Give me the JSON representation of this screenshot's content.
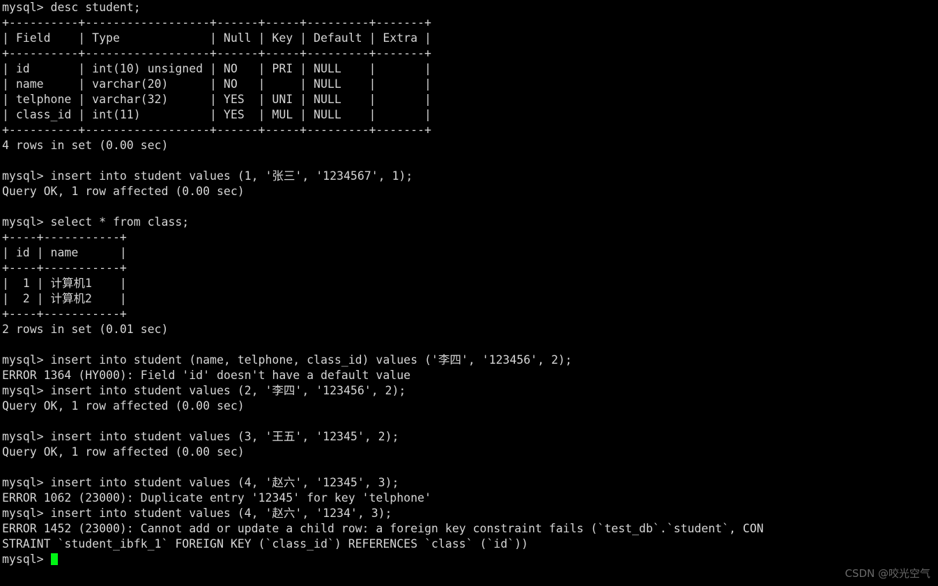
{
  "terminal": {
    "title": "mysql client session",
    "prompt": "mysql> ",
    "background_color": "#000000",
    "text_color": "#d6d6d6",
    "cursor_color": "#00f514",
    "lines": [
      "mysql> desc student;",
      "+----------+------------------+------+-----+---------+-------+",
      "| Field    | Type             | Null | Key | Default | Extra |",
      "+----------+------------------+------+-----+---------+-------+",
      "| id       | int(10) unsigned | NO   | PRI | NULL    |       |",
      "| name     | varchar(20)      | NO   |     | NULL    |       |",
      "| telphone | varchar(32)      | YES  | UNI | NULL    |       |",
      "| class_id | int(11)          | YES  | MUL | NULL    |       |",
      "+----------+------------------+------+-----+---------+-------+",
      "4 rows in set (0.00 sec)",
      "",
      "mysql> insert into student values (1, '张三', '1234567', 1);",
      "Query OK, 1 row affected (0.00 sec)",
      "",
      "mysql> select * from class;",
      "+----+-----------+",
      "| id | name      |",
      "+----+-----------+",
      "|  1 | 计算机1    |",
      "|  2 | 计算机2    |",
      "+----+-----------+",
      "2 rows in set (0.01 sec)",
      "",
      "mysql> insert into student (name, telphone, class_id) values ('李四', '123456', 2);",
      "ERROR 1364 (HY000): Field 'id' doesn't have a default value",
      "mysql> insert into student values (2, '李四', '123456', 2);",
      "Query OK, 1 row affected (0.00 sec)",
      "",
      "mysql> insert into student values (3, '王五', '12345', 2);",
      "Query OK, 1 row affected (0.00 sec)",
      "",
      "mysql> insert into student values (4, '赵六', '12345', 3);",
      "ERROR 1062 (23000): Duplicate entry '12345' for key 'telphone'",
      "mysql> insert into student values (4, '赵六', '1234', 3);",
      "ERROR 1452 (23000): Cannot add or update a child row: a foreign key constraint fails (`test_db`.`student`, CON",
      "STRAINT `student_ibfk_1` FOREIGN KEY (`class_id`) REFERENCES `class` (`id`))"
    ],
    "last_prompt": "mysql> ",
    "cursor_visible": true
  },
  "watermark": {
    "text": "CSDN @咬光空气"
  }
}
